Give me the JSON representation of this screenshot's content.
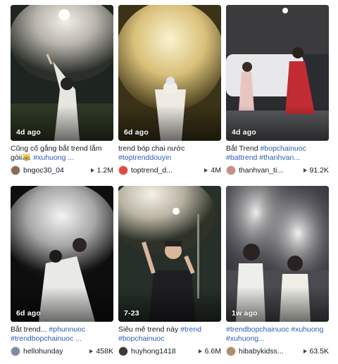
{
  "videos": [
    {
      "age": "4d ago",
      "caption_text": "Cũng cố gắng bắt trend lắm gòii😹 ",
      "caption_tags": "#xuhuong ...",
      "user": "bngoc30_04",
      "views": "1.2M",
      "avatar_color": "#8a6a55"
    },
    {
      "age": "6d ago",
      "caption_text": "trend bóp chai nước ",
      "caption_tags": "#toptrenddouyin",
      "user": "toptrend_d...",
      "views": "4M",
      "avatar_color": "#e8453c"
    },
    {
      "age": "4d ago",
      "caption_text": "Bắt Trend ",
      "caption_tags": "#bopchainuoc #battrend #thanhvan...",
      "user": "thanhvan_ti...",
      "views": "91.2K",
      "avatar_color": "#c98f86"
    },
    {
      "age": "6d ago",
      "caption_text": "Bắt trend... ",
      "caption_tags": "#phunnuoc #trendbopchainuoc ...",
      "user": "hellohunday",
      "views": "458K",
      "avatar_color": "#7a8aa8"
    },
    {
      "age": "7-23",
      "caption_text": "Siêu mê trend này ",
      "caption_tags": "#trend #bopchainuoc",
      "user": "huyhong1418",
      "views": "6.6M",
      "avatar_color": "#3a3a3a"
    },
    {
      "age": "1w ago",
      "caption_text": "",
      "caption_tags": "#trendbopchainuoc #xuhuong #xuhuong...",
      "user": "hibabykidss...",
      "views": "63.5K",
      "avatar_color": "#b58a6c"
    }
  ]
}
